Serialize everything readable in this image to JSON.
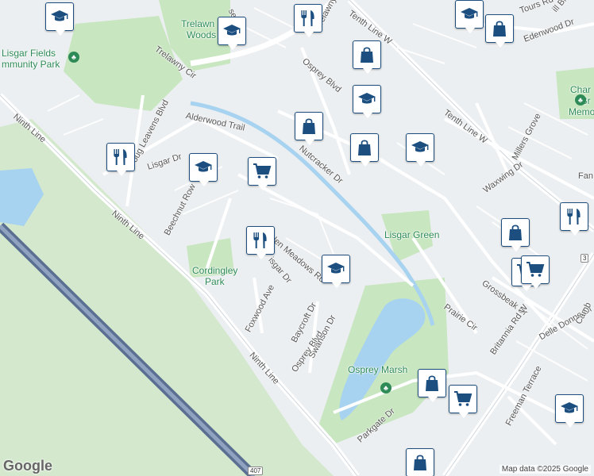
{
  "labels": {
    "lisgar_fields": "Lisgar Fields",
    "community_park": "mmunity Park",
    "trelawny_woods_1": "Trelawn",
    "trelawny_woods_2": "Woods",
    "lisgar_green": "Lisgar Green",
    "cordingley_park_1": "Cordingley",
    "cordingley_park_2": "Park",
    "osprey_marsh": "Osprey Marsh",
    "char_memo_1": "Char",
    "char_memo_2": "\" Br",
    "char_memo_3": "Memo"
  },
  "streets": {
    "trelawny_cir": "Trelawny Cir",
    "tenth_line_w_top": "Tenth Line W",
    "tenth_line_w_mid": "Tenth Line W",
    "tours_rd": "Tours Rd",
    "hill_blvd": "ill Blvd",
    "edenwood_dr": "Edenwood Dr",
    "osprey_blvd_top": "Osprey Blvd",
    "osprey_blvd_bottom": "Osprey Blvd",
    "alderwood_trail": "Alderwood Trail",
    "doug_leavens_blvd": "Doug Leavens Blvd",
    "ninth_line_top": "Ninth Line",
    "ninth_line_mid": "Ninth Line",
    "ninth_line_bottom": "Ninth Line",
    "lisgar_dr_left": "Lisgar Dr",
    "lisgar_dr_mid": "isgar Dr",
    "nutcracker_dr": "Nutcracker Dr",
    "beechnut_row": "Beechnut Row",
    "glen_meadows_rd": "Glen Meadows Rd",
    "foxwood_ave": "Foxwood Ave",
    "baycroft_dr": "Baycroft Dr",
    "swanson_dr": "Swanson Dr",
    "parkgate_dr": "Parkgate Dr",
    "prairie_cir": "Prairie Cir",
    "grossbeak_dr": "Grossbeak Dr",
    "waxwing_dr": "Waxwing Dr",
    "millers_grove": "Millers Grove",
    "britannia_rd_w": "Britannia Rd W",
    "delle_donne_dr": "Delle Donne Dr",
    "freeman_terrace": "Freeman Terrace",
    "camb": "Camb",
    "fan": "Fan",
    "lane": "se Ln"
  },
  "shields": {
    "route_3": "3",
    "route_407": "407"
  },
  "pois": [
    {
      "type": "school",
      "icon": "graduation-cap-icon"
    },
    {
      "type": "school",
      "icon": "graduation-cap-icon"
    },
    {
      "type": "restaurant",
      "icon": "fork-knife-icon"
    },
    {
      "type": "school",
      "icon": "graduation-cap-icon"
    },
    {
      "type": "shopping",
      "icon": "shopping-bag-icon"
    },
    {
      "type": "shopping",
      "icon": "shopping-bag-icon"
    },
    {
      "type": "school",
      "icon": "graduation-cap-icon"
    },
    {
      "type": "shopping",
      "icon": "shopping-bag-icon"
    },
    {
      "type": "shopping",
      "icon": "shopping-bag-icon"
    },
    {
      "type": "school",
      "icon": "graduation-cap-icon"
    },
    {
      "type": "restaurant",
      "icon": "fork-knife-icon"
    },
    {
      "type": "school",
      "icon": "graduation-cap-icon"
    },
    {
      "type": "grocery",
      "icon": "shopping-cart-icon"
    },
    {
      "type": "restaurant",
      "icon": "fork-knife-icon"
    },
    {
      "type": "school",
      "icon": "graduation-cap-icon"
    },
    {
      "type": "restaurant",
      "icon": "fork-knife-icon"
    },
    {
      "type": "shopping",
      "icon": "shopping-bag-icon"
    },
    {
      "type": "grocery",
      "icon": "shopping-cart-icon"
    },
    {
      "type": "grocery",
      "icon": "shopping-cart-icon"
    },
    {
      "type": "shopping",
      "icon": "shopping-bag-icon"
    },
    {
      "type": "grocery",
      "icon": "shopping-cart-icon"
    },
    {
      "type": "school",
      "icon": "graduation-cap-icon"
    },
    {
      "type": "shopping",
      "icon": "shopping-bag-icon"
    }
  ],
  "colors": {
    "pin_blue": "#1c4f80",
    "park_green": "#c8e6c0",
    "water": "#a7d3f0",
    "highway": "#6d7f9e"
  },
  "footer": {
    "google_logo": "Google",
    "attribution": "Map data ©2025 Google"
  }
}
